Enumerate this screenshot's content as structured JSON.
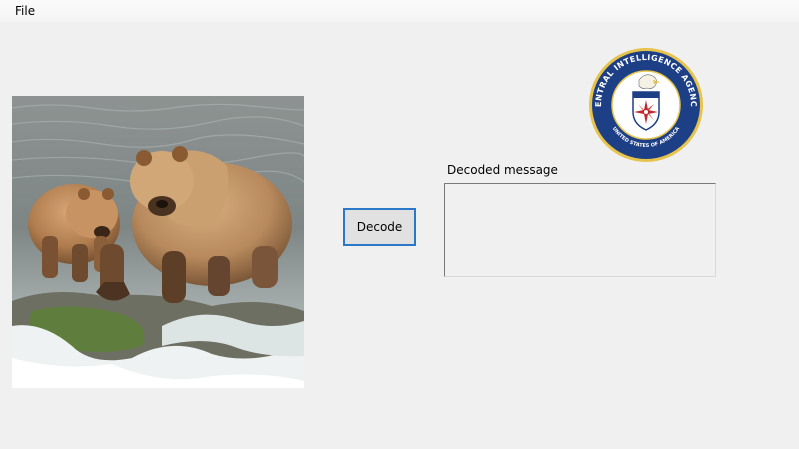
{
  "menu": {
    "items": [
      {
        "label": "File"
      }
    ]
  },
  "main": {
    "decode_button_label": "Decode",
    "decoded_message_label": "Decoded message",
    "decoded_message_value": ""
  },
  "images": {
    "photo": {
      "icon": "bears-photo"
    },
    "seal": {
      "icon": "cia-seal",
      "outer_text": "CENTRAL INTELLIGENCE AGENCY",
      "inner_text": "UNITED STATES OF AMERICA"
    }
  },
  "colors": {
    "window_bg": "#f0f0f0",
    "button_border": "#2a79c9",
    "seal_blue": "#1d3f86",
    "seal_gold": "#e6c34a",
    "seal_red": "#c0282d"
  }
}
